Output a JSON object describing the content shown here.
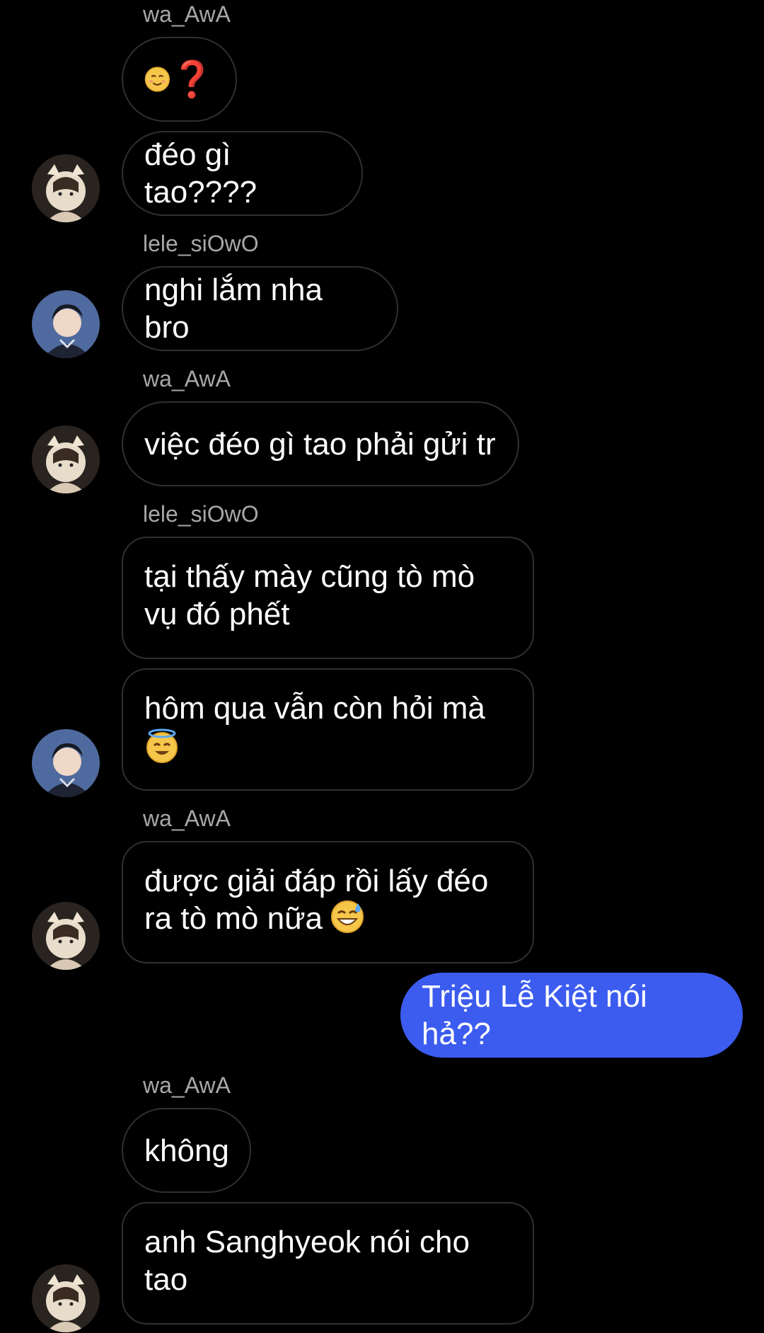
{
  "messages": [
    {
      "sender": "wa_AwA"
    },
    {
      "text": "❓",
      "emoji_prefix": "smiling-face-icon"
    },
    {
      "text": "đéo gì tao????"
    },
    {
      "sender": "lele_siOwO"
    },
    {
      "text": "nghi lắm nha bro"
    },
    {
      "sender": "wa_AwA"
    },
    {
      "text": "việc đéo gì tao phải gửi tr"
    },
    {
      "sender": "lele_siOwO"
    },
    {
      "text": "tại thấy mày cũng tò mò\nvụ đó phết"
    },
    {
      "text": "hôm qua vẫn còn hỏi mà",
      "emoji_suffix": "halo-face-icon"
    },
    {
      "sender": "wa_AwA"
    },
    {
      "text": "được giải đáp rồi lấy đéo\nra tò mò nữa",
      "emoji_suffix": "sweat-smile-icon"
    },
    {
      "text": "Triệu Lễ Kiệt nói hả??",
      "outgoing": true
    },
    {
      "sender": "wa_AwA"
    },
    {
      "text": "không"
    },
    {
      "text": "anh Sanghyeok nói cho\ntao"
    }
  ],
  "colors": {
    "background": "#000000",
    "incoming_border": "#2f2f2f",
    "outgoing_bubble": "#3c5cf0",
    "sender_label": "#a8a8a8"
  }
}
